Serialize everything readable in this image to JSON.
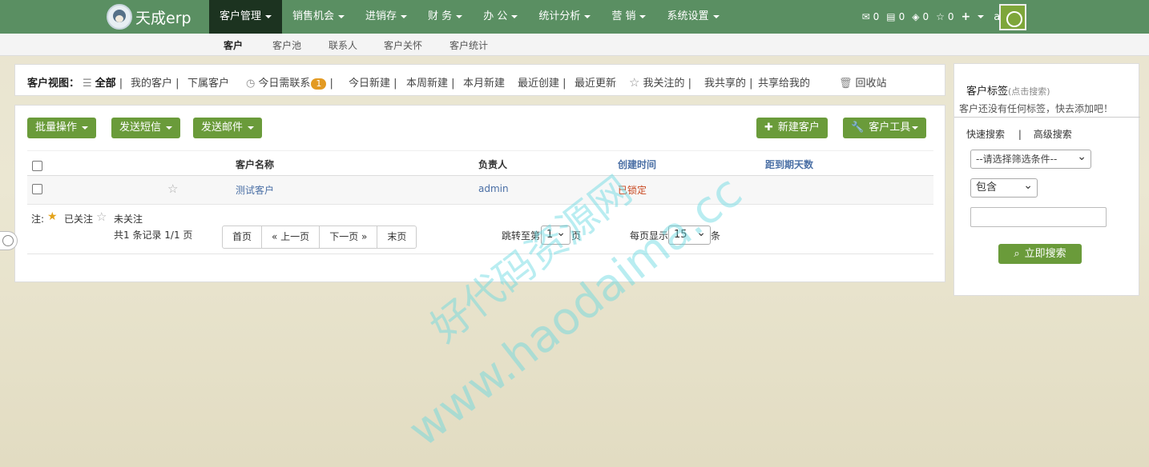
{
  "app": {
    "title": "天成erp"
  },
  "nav": {
    "items": [
      {
        "label": "客户管理",
        "active": true
      },
      {
        "label": "销售机会"
      },
      {
        "label": "进销存"
      },
      {
        "label": "财 务"
      },
      {
        "label": "办 公"
      },
      {
        "label": "统计分析"
      },
      {
        "label": "营 销"
      },
      {
        "label": "系统设置"
      }
    ],
    "tools": {
      "mail_count": "0",
      "card_count": "0",
      "diamond_count": "0",
      "star_count": "0"
    },
    "user": "admin"
  },
  "subnav": {
    "items": [
      "客户",
      "客户池",
      "联系人",
      "客户关怀",
      "客户统计"
    ]
  },
  "viewbar": {
    "label": "客户视图：",
    "all": "全部",
    "mine": "我的客户",
    "subordinate": "下属客户",
    "today_contact": "今日需联系",
    "today_contact_count": "1",
    "today_new": "今日新建",
    "week_new": "本周新建",
    "month_new": "本月新建",
    "recent_created": "最近创建",
    "recent_updated": "最近更新",
    "following": "我关注的",
    "my_shared": "我共享的",
    "shared_to_me": "共享给我的",
    "recycle": "回收站"
  },
  "toolbar": {
    "batch": "批量操作",
    "sms": "发送短信",
    "email": "发送邮件",
    "new_customer": "新建客户",
    "customer_tools": "客户工具"
  },
  "table": {
    "headers": {
      "name": "客户名称",
      "owner": "负责人",
      "created": "创建时间",
      "days_left": "距到期天数"
    },
    "rows": [
      {
        "name": "测试客户",
        "owner": "admin",
        "created": "已锁定"
      }
    ]
  },
  "footer": {
    "note_label": "注:",
    "followed": "已关注",
    "unfollowed": "未关注",
    "records": "共1 条记录 1/1 页",
    "pager": [
      "首页",
      "« 上一页",
      "下一页 »",
      "末页"
    ],
    "jump_prefix": "跳转至第",
    "jump_page": "1",
    "jump_suffix": "页",
    "per_page_prefix": "每页显示",
    "per_page": "15",
    "per_page_suffix": "条"
  },
  "sidebar": {
    "title": "客户标签",
    "title_hint": "(点击搜索)",
    "empty_text": "客户还没有任何标签，快去添加吧！",
    "tab_quick": "快速搜索",
    "tab_separator": "|",
    "tab_advanced": "高级搜索",
    "filter_placeholder": "--请选择筛选条件--",
    "operator": "包含",
    "search_button": "立即搜索"
  },
  "watermark": {
    "line1": "好代码资源网",
    "line2": "www.haodaima.cc"
  },
  "colors": {
    "nav_bg": "#5a8f62",
    "nav_active": "#1c3320",
    "accent_green": "#6a9b3a",
    "badge_orange": "#e39a22",
    "link_blue": "#4a6fa5",
    "locked_red": "#c8471f"
  }
}
